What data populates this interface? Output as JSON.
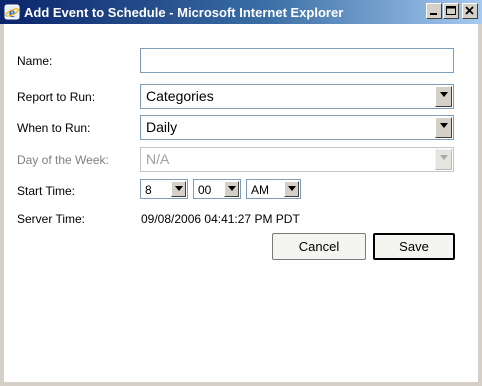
{
  "window": {
    "title": "Add Event to Schedule - Microsoft Internet Explorer"
  },
  "form": {
    "name_label": "Name:",
    "name_value": "",
    "report_label": "Report to Run:",
    "report_value": "Categories",
    "when_label": "When to Run:",
    "when_value": "Daily",
    "day_label": "Day of the Week:",
    "day_value": "N/A",
    "start_label": "Start Time:",
    "start_hour": "8",
    "start_minute": "00",
    "start_ampm": "AM",
    "server_label": "Server Time:",
    "server_time": "09/08/2006 04:41:27 PM PDT"
  },
  "buttons": {
    "cancel": "Cancel",
    "save": "Save"
  },
  "colors": {
    "title_gradient_start": "#0a246a",
    "title_gradient_end": "#a6caf0",
    "chrome": "#d4d0c8",
    "field_border": "#7f9db9"
  }
}
